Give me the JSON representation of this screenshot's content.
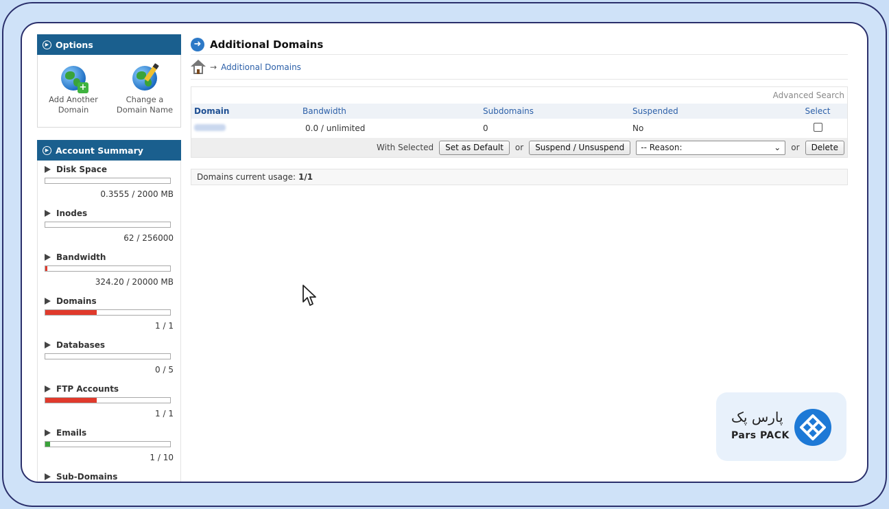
{
  "sidebar": {
    "options_title": "Options",
    "options": [
      {
        "label": "Add Another Domain",
        "icon": "globe-add-icon"
      },
      {
        "label": "Change a Domain Name",
        "icon": "globe-edit-icon"
      }
    ],
    "summary_title": "Account Summary",
    "summary": [
      {
        "title": "Disk Space",
        "value": "0.3555 / 2000 MB",
        "fill": 0.0002,
        "color": "#e03a2c"
      },
      {
        "title": "Inodes",
        "value": "62 / 256000",
        "fill": 0.0002,
        "color": "#e03a2c"
      },
      {
        "title": "Bandwidth",
        "value": "324.20 / 20000 MB",
        "fill": 0.016,
        "color": "#e03a2c"
      },
      {
        "title": "Domains",
        "value": "1 / 1",
        "fill": 0.41,
        "color": "#e03a2c"
      },
      {
        "title": "Databases",
        "value": "0 / 5",
        "fill": 0,
        "color": "#e03a2c"
      },
      {
        "title": "FTP Accounts",
        "value": "1 / 1",
        "fill": 0.41,
        "color": "#e03a2c"
      },
      {
        "title": "Emails",
        "value": "1 / 10",
        "fill": 0.04,
        "color": "#3aa33a"
      },
      {
        "title": "Sub-Domains",
        "value": "",
        "fill": 0,
        "color": "#e03a2c"
      }
    ]
  },
  "main": {
    "title": "Additional Domains",
    "breadcrumb_arrow": "→",
    "breadcrumb_link": "Additional Domains",
    "advanced_search": "Advanced Search",
    "columns": [
      "Domain",
      "Bandwidth",
      "Subdomains",
      "Suspended",
      "Select"
    ],
    "rows": [
      {
        "bandwidth": "0.0 / unlimited",
        "subdomains": "0",
        "suspended": "No"
      }
    ],
    "with_selected": "With Selected",
    "set_default": "Set as Default",
    "or": "or",
    "suspend": "Suspend / Unsuspend",
    "reason_placeholder": "-- Reason:",
    "delete": "Delete",
    "usage_label": "Domains current usage:",
    "usage_value": "1/1"
  },
  "brand": {
    "name_fa": "پارس پک",
    "name_en": "Pars PACK",
    "color": "#1d79d6"
  }
}
